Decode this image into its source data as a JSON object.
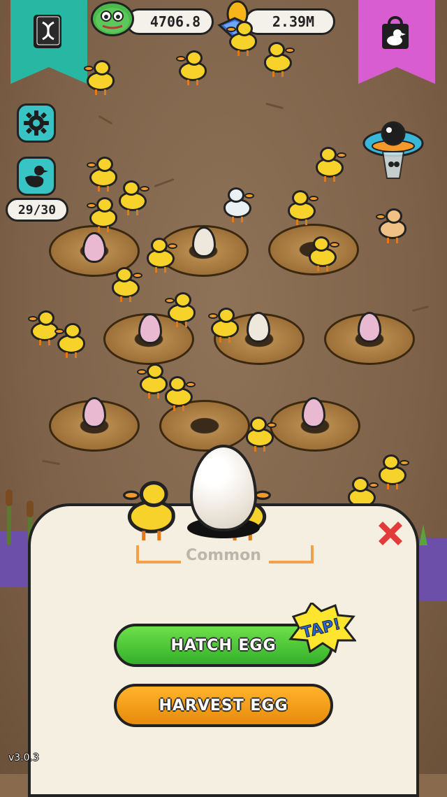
{
  "hud": {
    "coin_value": "4706.8",
    "gem_value": "2.39M",
    "duck_count": "29/30",
    "dex_icon": "dna-book-icon",
    "shop_icon": "shopping-bag-duck-icon",
    "settings_icon": "gear-icon",
    "ducks_icon": "duck-silhouette-icon"
  },
  "popup": {
    "rarity": "Common",
    "hatch_label": "HATCH EGG",
    "harvest_label": "HARVEST EGG",
    "tap_label": "TAP!"
  },
  "footer": {
    "version": "v3.0.3"
  },
  "colors": {
    "dex_banner": "#27b7a3",
    "shop_banner": "#d85dd0",
    "hatch_button": "#3fc22f",
    "harvest_button": "#f29c18",
    "close_x": "#e23b3b",
    "duck_yellow": "#f7d22b"
  }
}
